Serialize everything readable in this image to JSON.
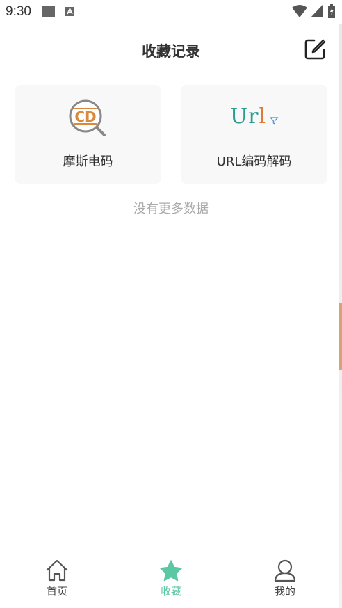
{
  "status_bar": {
    "time": "9:30"
  },
  "header": {
    "title": "收藏记录",
    "edit_icon": "edit-icon"
  },
  "cards": [
    {
      "label": "摩斯电码",
      "icon": "morse-code-icon",
      "logo_text": "CD"
    },
    {
      "label": "URL编码解码",
      "icon": "url-codec-icon",
      "logo_text_1": "Ur",
      "logo_text_2": "l"
    }
  ],
  "empty_text": "没有更多数据",
  "bottom_nav": {
    "items": [
      {
        "label": "首页",
        "icon": "home-icon"
      },
      {
        "label": "收藏",
        "icon": "star-icon",
        "active": true
      },
      {
        "label": "我的",
        "icon": "user-icon"
      }
    ]
  },
  "colors": {
    "accent": "#5bc7a3",
    "card_bg": "#f8f8f8",
    "morse_orange": "#d98a3f",
    "url_teal": "#2a9d8f"
  }
}
